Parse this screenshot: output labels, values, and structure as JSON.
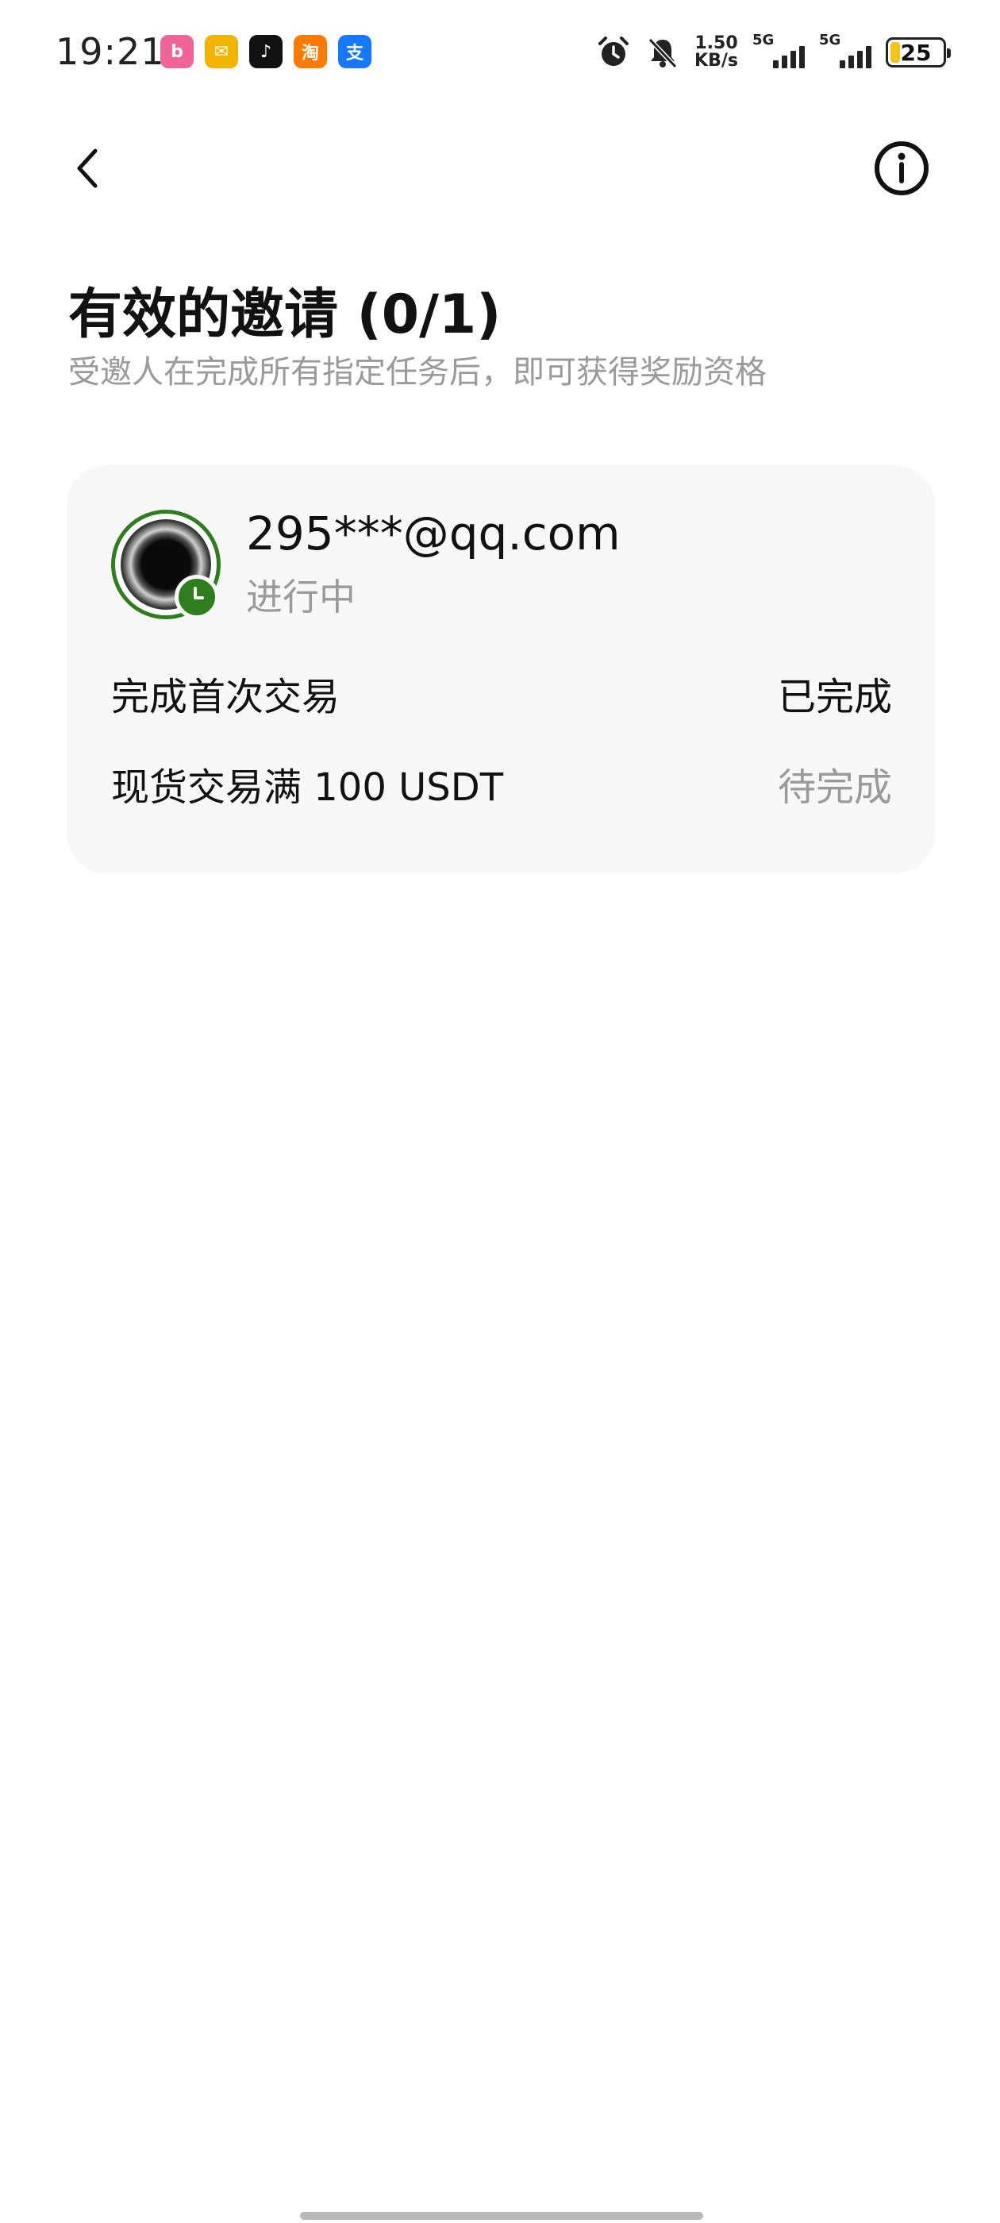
{
  "status_bar": {
    "time": "19:21",
    "apps": [
      {
        "name": "bilibili-icon",
        "color": "#f0649a",
        "glyph": "b"
      },
      {
        "name": "mail-icon",
        "color": "#f2b400",
        "glyph": "✉"
      },
      {
        "name": "douyin-icon",
        "color": "#111111",
        "glyph": "♪"
      },
      {
        "name": "taobao-icon",
        "color": "#ff7a00",
        "glyph": "淘"
      },
      {
        "name": "alipay-icon",
        "color": "#1677ff",
        "glyph": "支"
      }
    ],
    "net_speed_value": "1.50",
    "net_speed_unit": "KB/s",
    "sim1_label": "5G",
    "sim2_label": "5G",
    "battery": "25",
    "battery_level": 0.25
  },
  "header": {
    "back_icon": "chevron-left-icon",
    "info_icon": "info-icon"
  },
  "page": {
    "title": "有效的邀请 (0/1)",
    "subtitle": "受邀人在完成所有指定任务后，即可获得奖励资格"
  },
  "invite": {
    "email": "295***@qq.com",
    "status": "进行中",
    "badge_icon": "clock-icon",
    "accent_color": "#2e7d1e",
    "tasks": [
      {
        "name": "完成首次交易",
        "status": "已完成",
        "status_color": "#111111"
      },
      {
        "name": "现货交易满 100 USDT",
        "status": "待完成",
        "status_color": "#9a9a9a"
      }
    ]
  }
}
